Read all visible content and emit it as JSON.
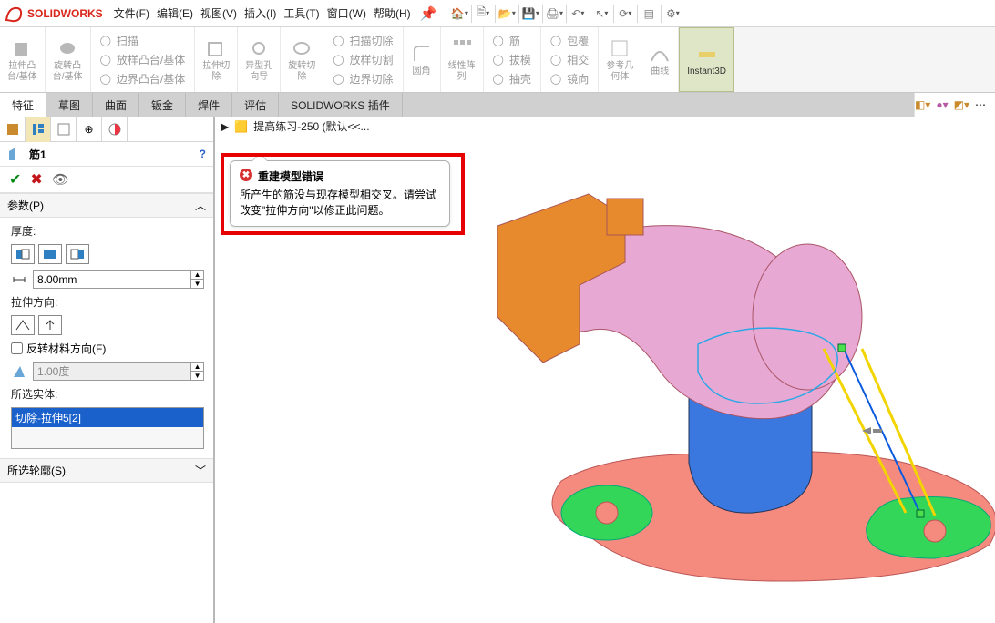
{
  "app": {
    "name": "SOLIDWORKS"
  },
  "menu": {
    "file": "文件(F)",
    "edit": "编辑(E)",
    "view": "视图(V)",
    "insert": "插入(I)",
    "tools": "工具(T)",
    "window": "窗口(W)",
    "help": "帮助(H)"
  },
  "ribbon": {
    "extrude": "拉伸凸\n台/基体",
    "revolve": "旋转凸\n台/基体",
    "sweep": "扫描",
    "loft": "放样凸台/基体",
    "boundary": "边界凸台/基体",
    "cut_extrude": "拉伸切\n除",
    "hole": "异型孔\n向导",
    "cut_revolve": "旋转切\n除",
    "cut_sweep": "扫描切除",
    "cut_loft": "放样切割",
    "cut_boundary": "边界切除",
    "fillet": "圆角",
    "linear": "线性阵\n列",
    "rib": "筋",
    "wrap": "包覆",
    "draft": "拔模",
    "intersect": "相交",
    "shell": "抽壳",
    "mirror": "镜向",
    "refgeo": "参考几\n何体",
    "curve": "曲线",
    "instant3d": "Instant3D"
  },
  "tabs": {
    "features": "特征",
    "sketch": "草图",
    "surface": "曲面",
    "sheetmetal": "钣金",
    "weldments": "焊件",
    "evaluate": "评估",
    "addins": "SOLIDWORKS 插件"
  },
  "panel": {
    "title": "筋1",
    "params_header": "参数(P)",
    "thickness_label": "厚度:",
    "thickness_value": "8.00mm",
    "direction_label": "拉伸方向:",
    "reverse_mat": "反转材料方向(F)",
    "angle_value": "1.00度",
    "selected_label": "所选实体:",
    "selected_item": "切除-拉伸5[2]",
    "contours_header": "所选轮廓(S)"
  },
  "breadcrumb": {
    "doc": "提高练习-250  (默认<<..."
  },
  "error": {
    "title": "重建模型错误",
    "body": "所产生的筋没与现存模型相交叉。请尝试改变\"拉伸方向\"以修正此问题。"
  }
}
